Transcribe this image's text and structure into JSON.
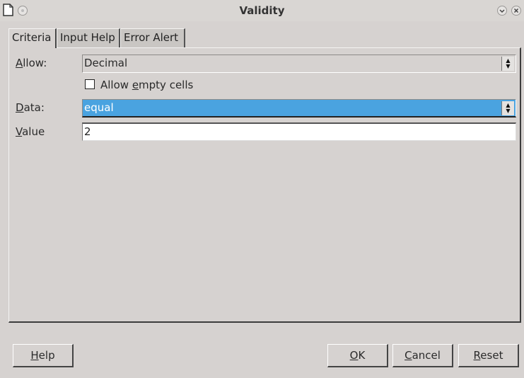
{
  "window": {
    "title": "Validity"
  },
  "tabs": [
    {
      "label": "Criteria",
      "active": true
    },
    {
      "label": "Input Help",
      "active": false
    },
    {
      "label": "Error Alert",
      "active": false
    }
  ],
  "criteria": {
    "allow": {
      "label_mnemonic": "A",
      "label_rest": "llow:",
      "value": "Decimal"
    },
    "allow_empty": {
      "label_pre": "Allow ",
      "label_mnemonic": "e",
      "label_rest": "mpty cells",
      "checked": false
    },
    "data": {
      "label_mnemonic": "D",
      "label_rest": "ata:",
      "value": "equal"
    },
    "value": {
      "label_mnemonic": "V",
      "label_rest": "alue",
      "value": "2"
    }
  },
  "buttons": {
    "help": {
      "mnemonic": "H",
      "rest": "elp"
    },
    "ok": {
      "mnemonic": "O",
      "rest": "K"
    },
    "cancel": {
      "mnemonic": "C",
      "rest": "ancel"
    },
    "reset": {
      "mnemonic": "R",
      "rest": "eset"
    }
  },
  "colors": {
    "highlight": "#4aa3e0",
    "background": "#d6d2d0"
  },
  "icons": {
    "window": "document-icon",
    "menu": "circle-icon",
    "minimize": "minimize-icon",
    "close": "close-icon"
  }
}
